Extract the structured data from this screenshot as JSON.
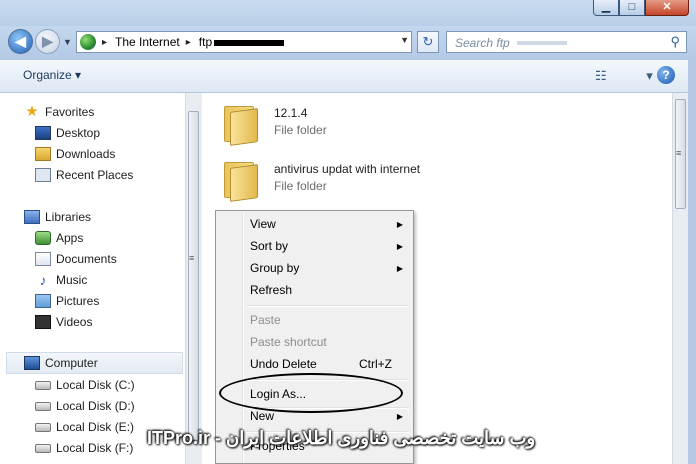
{
  "window": {
    "caption_buttons": {
      "minimize": "▁",
      "maximize": "□",
      "close": "✕"
    }
  },
  "address": {
    "back_glyph": "◀",
    "forward_glyph": "▶",
    "recent_glyph": "▼",
    "separator": "▸",
    "segments": [
      "The Internet",
      "ftp"
    ],
    "dropdown_glyph": "▼",
    "refresh_glyph": "↻",
    "search_placeholder": "Search ftp",
    "search_glyph": "⚲"
  },
  "toolbar": {
    "organize": "Organize ▾",
    "views_glyph": "☷ ▾",
    "help": "?"
  },
  "nav": {
    "favorites_title": "Favorites",
    "favorites": [
      "Desktop",
      "Downloads",
      "Recent Places"
    ],
    "libraries_title": "Libraries",
    "libraries": [
      "Apps",
      "Documents",
      "Music",
      "Pictures",
      "Videos"
    ],
    "computer_title": "Computer",
    "drives": [
      "Local Disk (C:)",
      "Local Disk (D:)",
      "Local Disk (E:)",
      "Local Disk (F:)"
    ]
  },
  "files": [
    {
      "name": "12.1.4",
      "type": "File folder"
    },
    {
      "name": "antivirus updat with internet",
      "type": "File folder"
    }
  ],
  "context_menu": {
    "items": [
      {
        "label": "View",
        "submenu": true,
        "disabled": false,
        "shortcut": ""
      },
      {
        "label": "Sort by",
        "submenu": true,
        "disabled": false,
        "shortcut": ""
      },
      {
        "label": "Group by",
        "submenu": true,
        "disabled": false,
        "shortcut": ""
      },
      {
        "label": "Refresh",
        "submenu": false,
        "disabled": false,
        "shortcut": ""
      },
      {
        "label": "Paste",
        "submenu": false,
        "disabled": true,
        "shortcut": ""
      },
      {
        "label": "Paste shortcut",
        "submenu": false,
        "disabled": true,
        "shortcut": ""
      },
      {
        "label": "Undo Delete",
        "submenu": false,
        "disabled": false,
        "shortcut": "Ctrl+Z"
      },
      {
        "label": "Login As...",
        "submenu": false,
        "disabled": false,
        "shortcut": ""
      },
      {
        "label": "New",
        "submenu": true,
        "disabled": false,
        "shortcut": ""
      },
      {
        "label": "Properties",
        "submenu": false,
        "disabled": false,
        "shortcut": ""
      }
    ],
    "submenu_glyph": "▶"
  },
  "watermark": "ITPro.ir - وب سایت تخصصی فناوری اطلاعات ایران",
  "colors": {
    "accent": "#1f5fb5",
    "titlebar": "#b8cfe8",
    "close": "#c5452a"
  }
}
